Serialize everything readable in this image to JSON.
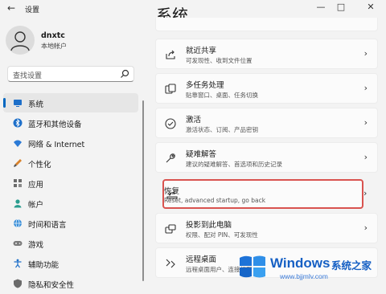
{
  "window": {
    "title": "设置",
    "back_glyph": "←",
    "minimize_glyph": "—",
    "maximize_glyph": "□",
    "close_glyph": "✕"
  },
  "user": {
    "name": "dnxtc",
    "account_type": "本地帐户"
  },
  "search": {
    "placeholder": "查找设置"
  },
  "nav": {
    "items": [
      {
        "label": "系统",
        "icon": "monitor-icon",
        "active": true
      },
      {
        "label": "蓝牙和其他设备",
        "icon": "bluetooth-icon"
      },
      {
        "label": "网络 & Internet",
        "icon": "wifi-icon"
      },
      {
        "label": "个性化",
        "icon": "brush-icon"
      },
      {
        "label": "应用",
        "icon": "apps-icon"
      },
      {
        "label": "帐户",
        "icon": "person-icon"
      },
      {
        "label": "时间和语言",
        "icon": "globe-icon"
      },
      {
        "label": "游戏",
        "icon": "gamepad-icon"
      },
      {
        "label": "辅助功能",
        "icon": "accessibility-icon"
      },
      {
        "label": "隐私和安全性",
        "icon": "shield-icon"
      }
    ]
  },
  "main": {
    "title": "系统",
    "cards": [
      {
        "title": "就近共享",
        "desc": "可发现性、收到文件位置",
        "icon": "share-icon"
      },
      {
        "title": "多任务处理",
        "desc": "贴靠窗口、桌面、任务切换",
        "icon": "multitask-icon"
      },
      {
        "title": "激活",
        "desc": "激活状态、订阅、产品密钥",
        "icon": "check-circle-icon"
      },
      {
        "title": "疑难解答",
        "desc": "建议的疑难解答、首选项和历史记录",
        "icon": "wrench-icon"
      },
      {
        "title": "恢复",
        "desc": "Reset, advanced startup, go back",
        "icon": "recovery-icon",
        "highlighted": true
      },
      {
        "title": "投影到此电脑",
        "desc": "权限、配对 PIN、可发现性",
        "icon": "projector-icon"
      },
      {
        "title": "远程桌面",
        "desc": "远程桌面用户、连接权限",
        "icon": "remote-desktop-icon"
      }
    ],
    "chevron_glyph": "›"
  },
  "watermark": {
    "brand": "Windows",
    "cn_text": "系统之家",
    "url": "www.bjjmlv.com",
    "logo_colors": [
      "#1e73d8",
      "#2f8fe8",
      "#1565c8",
      "#3aa0f0"
    ]
  },
  "colors": {
    "accent": "#0067c0",
    "highlight_border": "#d9534f"
  }
}
